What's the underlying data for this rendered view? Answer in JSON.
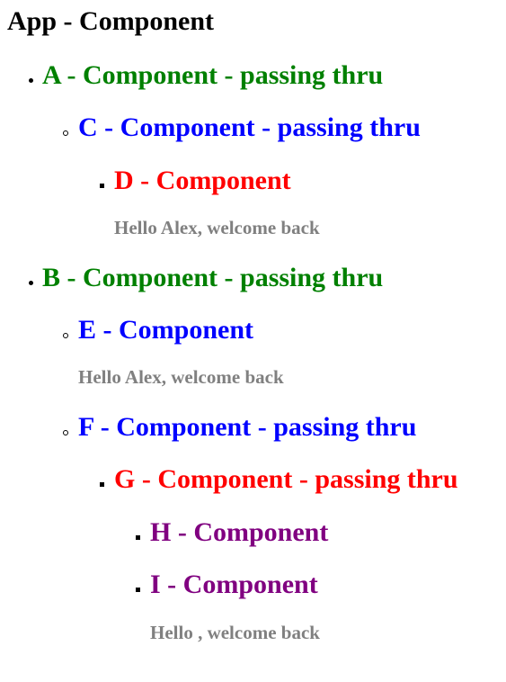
{
  "app": {
    "title": "App - Component"
  },
  "colors": {
    "green": "#008000",
    "blue": "#0000ff",
    "red": "#ff0000",
    "purple": "#800080",
    "gray": "#808080"
  },
  "tree": {
    "a": {
      "label": "A - Component - passing thru"
    },
    "c": {
      "label": "C - Component - passing thru"
    },
    "d": {
      "label": "D - Component",
      "message": "Hello Alex, welcome back"
    },
    "b": {
      "label": "B - Component - passing thru"
    },
    "e": {
      "label": "E - Component",
      "message": "Hello Alex, welcome back"
    },
    "f": {
      "label": "F - Component - passing thru"
    },
    "g": {
      "label": "G - Component - passing thru"
    },
    "h": {
      "label": "H - Component"
    },
    "i": {
      "label": "I - Component",
      "message": "Hello , welcome back"
    }
  }
}
